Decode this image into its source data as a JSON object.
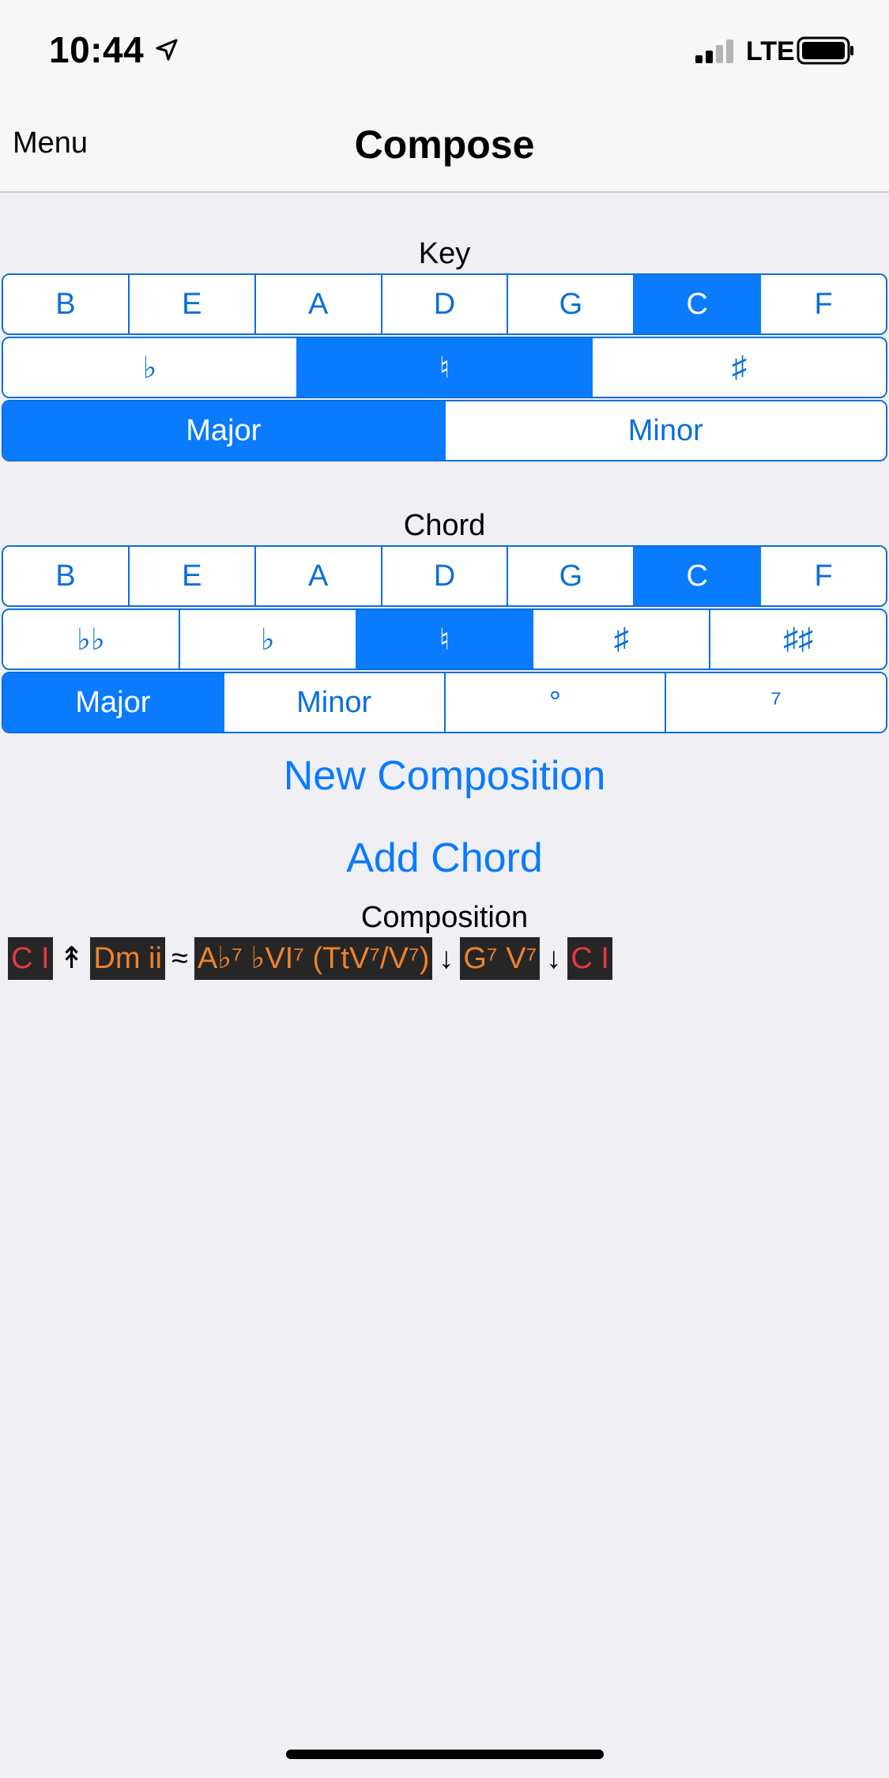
{
  "status_bar": {
    "time": "10:44",
    "network": "LTE"
  },
  "nav": {
    "menu": "Menu",
    "title": "Compose"
  },
  "key": {
    "label": "Key",
    "notes": [
      "B",
      "E",
      "A",
      "D",
      "G",
      "C",
      "F"
    ],
    "notes_selected": "C",
    "accidentals": [
      "♭",
      "♮",
      "♯"
    ],
    "accidentals_selected": "♮",
    "qualities": [
      "Major",
      "Minor"
    ],
    "qualities_selected": "Major"
  },
  "chord": {
    "label": "Chord",
    "notes": [
      "B",
      "E",
      "A",
      "D",
      "G",
      "C",
      "F"
    ],
    "notes_selected": "C",
    "accidentals": [
      "♭♭",
      "♭",
      "♮",
      "♯",
      "♯♯"
    ],
    "accidentals_selected": "♮",
    "qualities": [
      "Major",
      "Minor",
      "°",
      "⁷"
    ],
    "qualities_selected": "Major"
  },
  "actions": {
    "new_composition": "New Composition",
    "add_chord": "Add Chord"
  },
  "composition": {
    "label": "Composition",
    "items": [
      {
        "kind": "chip",
        "text": "C I",
        "color": "#e5393f"
      },
      {
        "kind": "sym",
        "text": "↟"
      },
      {
        "kind": "chip",
        "text": "Dm ii",
        "color": "#f0822a"
      },
      {
        "kind": "sym",
        "text": "≈"
      },
      {
        "kind": "chip",
        "text": "A♭⁷ ♭VI⁷ (TtV⁷/V⁷)",
        "color": "#f0822a"
      },
      {
        "kind": "sym",
        "text": "↓"
      },
      {
        "kind": "chip",
        "text": "G⁷ V⁷",
        "color": "#f0822a"
      },
      {
        "kind": "sym",
        "text": "↓"
      },
      {
        "kind": "chip",
        "text": "C I",
        "color": "#e5393f"
      }
    ]
  },
  "colors": {
    "accent": "#0a7afe",
    "chip_bg": "#262626",
    "tonic": "#e5393f",
    "other": "#f0822a"
  }
}
